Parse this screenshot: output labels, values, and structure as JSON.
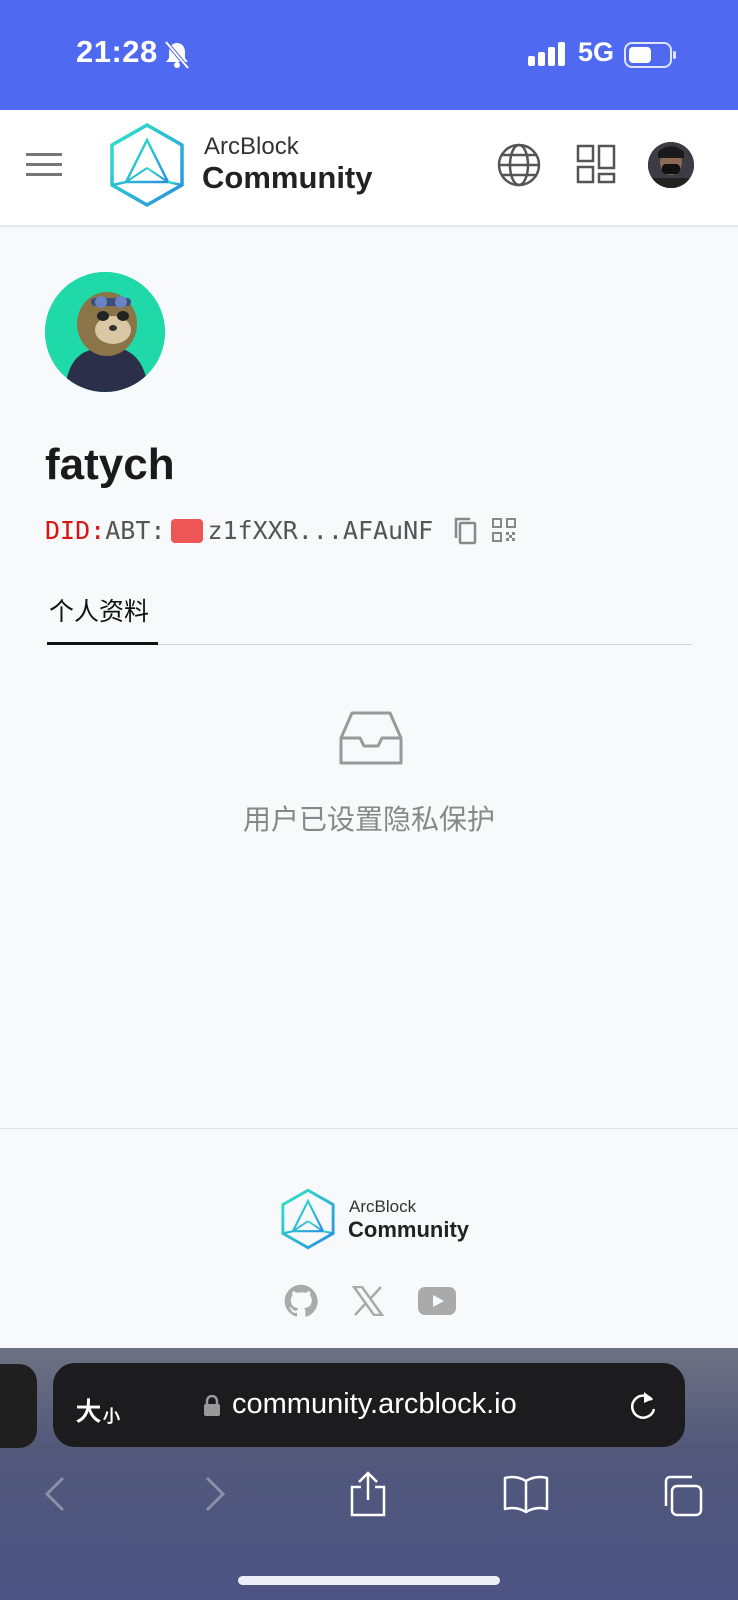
{
  "status_bar": {
    "time": "21:28",
    "network": "5G"
  },
  "header": {
    "logo_top": "ArcBlock",
    "logo_bottom": "Community"
  },
  "profile": {
    "username": "fatych",
    "did_prefix": "DID:",
    "did_type": "ABT:",
    "did_address": "z1fXXR...AFAuNF"
  },
  "tabs": [
    {
      "label": "个人资料",
      "active": true
    }
  ],
  "empty_state": {
    "message": "用户已设置隐私保护"
  },
  "footer": {
    "logo_top": "ArcBlock",
    "logo_bottom": "Community",
    "social": [
      "github-icon",
      "x-icon",
      "youtube-icon"
    ]
  },
  "browser": {
    "text_size_big": "大",
    "text_size_small": "小",
    "url": "community.arcblock.io"
  },
  "colors": {
    "status_bar": "#4f6af0",
    "accent_teal": "#27c4c9",
    "did_red": "#dd1111"
  }
}
